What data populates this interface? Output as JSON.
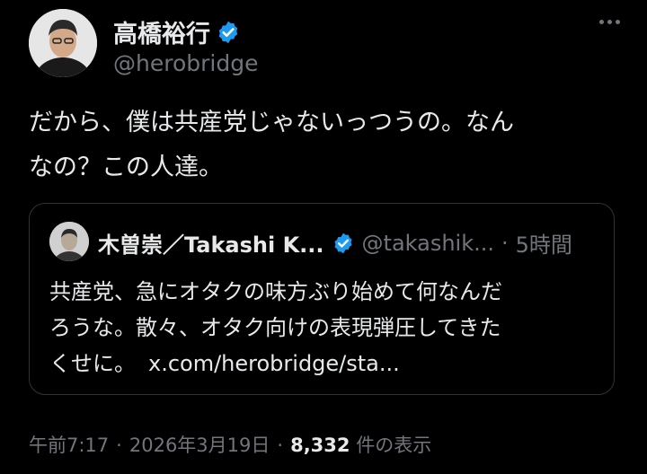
{
  "author": {
    "display_name": "高橋裕行",
    "handle": "@herobridge"
  },
  "tweet": {
    "text_line1": "だから、僕は共産党じゃないっつうの。なん",
    "text_line2": "なの？この人達。"
  },
  "quoted_tweet": {
    "display_name": "木曽崇／Takashi K...",
    "handle": "@takashik...",
    "dot": "·",
    "time": "5時間",
    "text_line1": "共産党、急にオタクの味方ぶり始めて何なんだ",
    "text_line2": "ろうな。散々、オタク向けの表現弾圧してきた",
    "text_line3": "くせに。",
    "link": "x.com/herobridge/sta..."
  },
  "meta": {
    "time": "午前7:17",
    "sep1": "·",
    "date": "2026年3月19日",
    "sep2": "·",
    "views_count": "8,332",
    "views_label": "件の表示"
  },
  "colors": {
    "background": "#000000",
    "text": "#e7e9ea",
    "secondary": "#71767b",
    "verified": "#1d9bf0",
    "border": "#2f3336"
  },
  "icons": {
    "verified": "verified-badge-icon",
    "more": "more-horizontal-icon"
  }
}
